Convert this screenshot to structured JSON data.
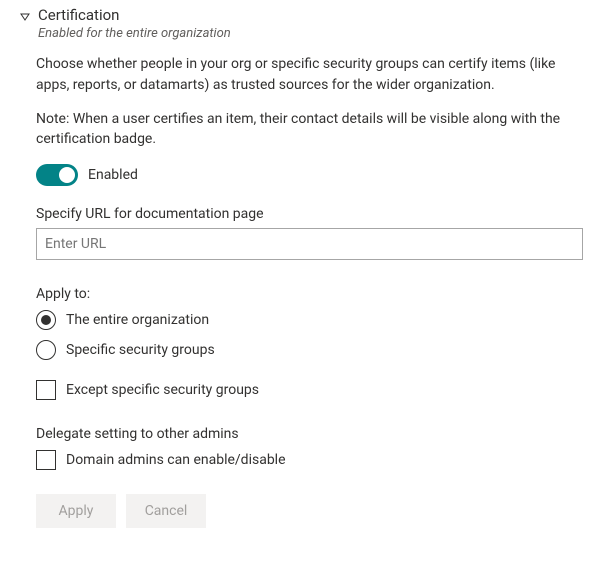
{
  "header": {
    "title": "Certification",
    "subtitle": "Enabled for the entire organization"
  },
  "description": "Choose whether people in your org or specific security groups can certify items (like apps, reports, or datamarts) as trusted sources for the wider organization.",
  "note": "Note: When a user certifies an item, their contact details will be visible along with the certification badge.",
  "toggle": {
    "state_label": "Enabled"
  },
  "url_field": {
    "label": "Specify URL for documentation page",
    "placeholder": "Enter URL",
    "value": ""
  },
  "apply_to": {
    "label": "Apply to:",
    "options": {
      "entire_org": "The entire organization",
      "specific_groups": "Specific security groups"
    },
    "except_label": "Except specific security groups"
  },
  "delegate": {
    "label": "Delegate setting to other admins",
    "option": "Domain admins can enable/disable"
  },
  "actions": {
    "apply": "Apply",
    "cancel": "Cancel"
  }
}
